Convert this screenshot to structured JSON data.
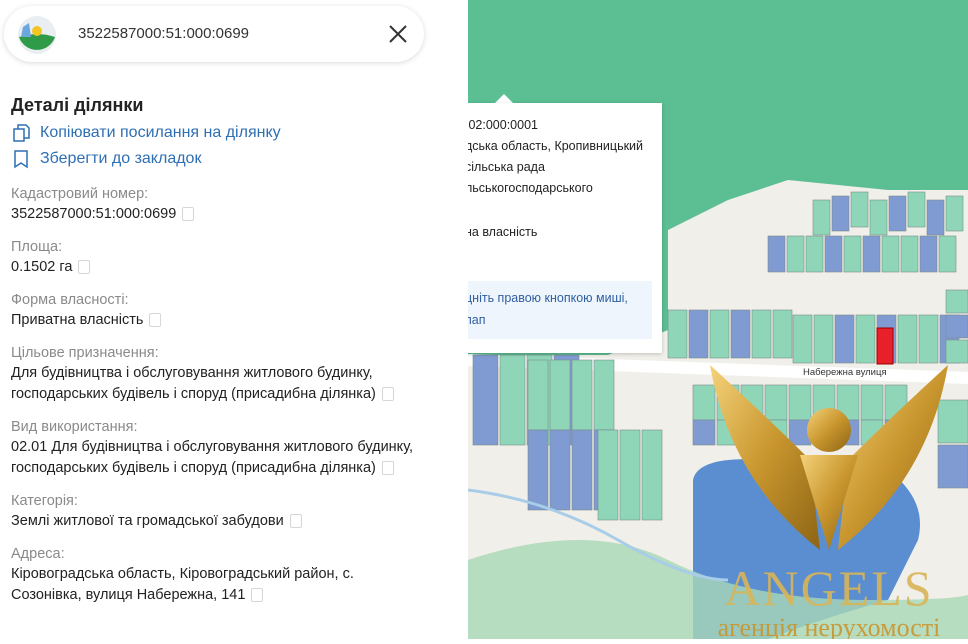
{
  "search": {
    "value": "3522587000:51:000:0699"
  },
  "details": {
    "title": "Деталі ділянки",
    "copy_link": "Копіювати посилання на ділянку",
    "bookmark": "Зберегти до закладок",
    "fields": [
      {
        "label": "Кадастровий номер:",
        "lines": [
          "3522587000:51:000:0699"
        ]
      },
      {
        "label": "Площа:",
        "lines": [
          "0.1502 га"
        ]
      },
      {
        "label": "Форма власності:",
        "lines": [
          "Приватна власність"
        ]
      },
      {
        "label": "Цільове призначення:",
        "lines": [
          "Для будівництва і обслуговування житлового будинку,",
          "господарських будівель і споруд (присадибна ділянка)"
        ]
      },
      {
        "label": "Вид використання:",
        "lines": [
          "02.01 Для будівництва і обслуговування житлового будинку,",
          "господарських будівель і споруд (присадибна ділянка)"
        ]
      },
      {
        "label": "Категорія:",
        "lines": [
          "Землі житлової та громадської забудови"
        ]
      },
      {
        "label": "Адреса:",
        "lines": [
          "Кіровоградська область, Кіровоградський район, с.",
          "Созонівка, вулиця Набережна, 141"
        ]
      }
    ]
  },
  "popup": {
    "lines": [
      ":02:000:0001",
      "дська область, Кропивницький",
      " сільська рада",
      "льськогосподарського",
      "на власність"
    ],
    "hint": [
      "цніть правою кнопкою миші,",
      "пап"
    ]
  },
  "map": {
    "street_label": "Набережна вулиця"
  },
  "watermark": {
    "brand": "ANGELS",
    "subtitle": "агенція нерухомості"
  },
  "colors": {
    "link": "#2f6fb3",
    "forest": "#5cbf93",
    "selected_parcel": "#e8202a",
    "water": "#5a8ed0"
  }
}
